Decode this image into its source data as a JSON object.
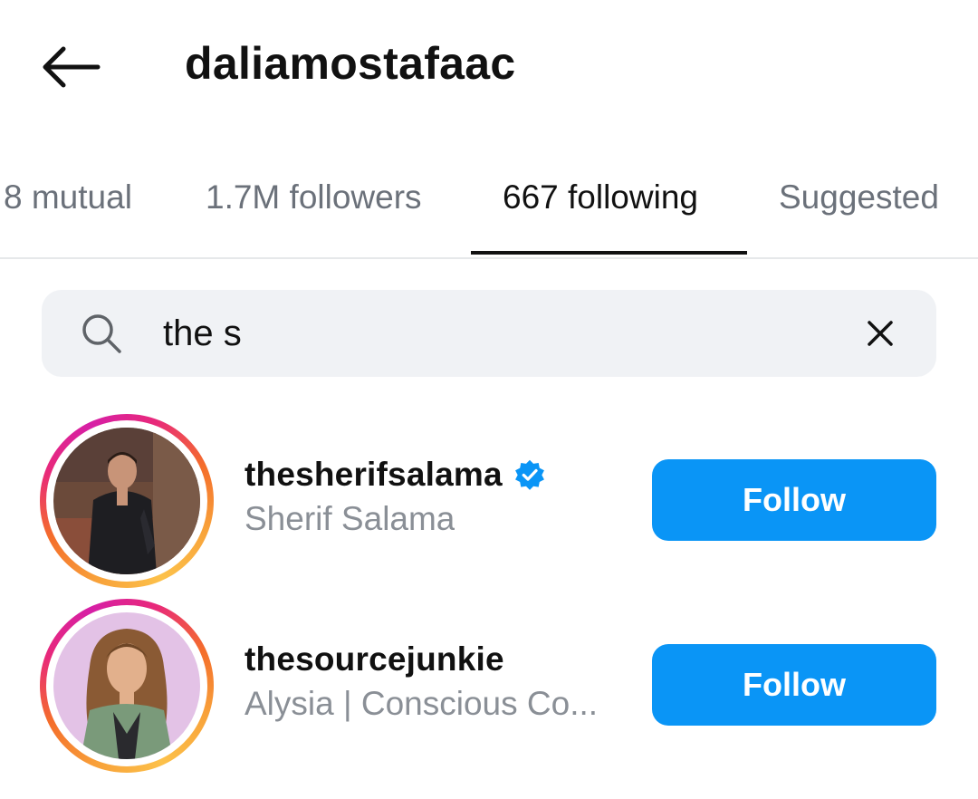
{
  "header": {
    "title": "daliamostafaac",
    "back_icon": "arrow-left-icon"
  },
  "tabs": [
    {
      "label": "8 mutual",
      "active": false
    },
    {
      "label": "1.7M followers",
      "active": false
    },
    {
      "label": "667 following",
      "active": true
    },
    {
      "label": "Suggested",
      "active": false
    }
  ],
  "search": {
    "value": "the s",
    "icon": "search-icon",
    "clear_icon": "close-icon"
  },
  "results": [
    {
      "username": "thesherifsalama",
      "verified": true,
      "full_name": "Sherif Salama",
      "button_label": "Follow"
    },
    {
      "username": "thesourcejunkie",
      "verified": false,
      "full_name": "Alysia | Conscious Co...",
      "button_label": "Follow"
    }
  ],
  "colors": {
    "follow_button": "#0a95f6",
    "verified_badge": "#0a95f6",
    "inactive_tab": "#6b717a",
    "search_background": "#f0f2f5"
  }
}
